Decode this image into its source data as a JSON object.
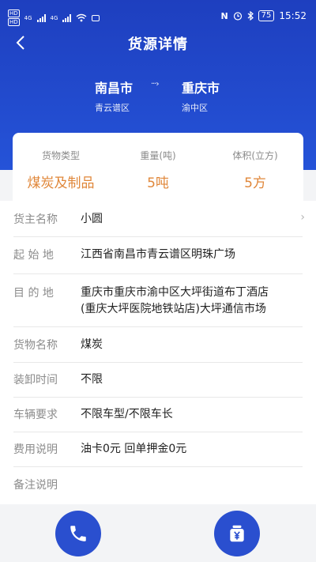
{
  "status_bar": {
    "left_badges": [
      "HD",
      "HD"
    ],
    "network_labels": [
      "4G",
      "4G"
    ],
    "battery": "75",
    "time": "15:52"
  },
  "nav": {
    "title": "货源详情"
  },
  "route": {
    "from_city": "南昌市",
    "from_district": "青云谱区",
    "to_city": "重庆市",
    "to_district": "渝中区"
  },
  "summary": {
    "cargo_type_label": "货物类型",
    "cargo_type_value": "煤炭及制品",
    "weight_label": "重量(吨)",
    "weight_value": "5吨",
    "volume_label": "体积(立方)",
    "volume_value": "5方"
  },
  "details": [
    {
      "key": "货主名称",
      "value": "小圆"
    },
    {
      "key": "起 始 地",
      "value": "江西省南昌市青云谱区明珠广场"
    },
    {
      "key": "目 的 地",
      "value_line1": "重庆市重庆市渝中区大坪街道布丁酒店",
      "value_line2": "(重庆大坪医院地铁站店)大坪通信市场"
    },
    {
      "key": "货物名称",
      "value": "煤炭"
    },
    {
      "key": "装卸时间",
      "value": "不限"
    },
    {
      "key": "车辆要求",
      "value": "不限车型/不限车长"
    },
    {
      "key": "费用说明",
      "value": "油卡0元 回单押金0元"
    },
    {
      "key": "备注说明",
      "value": ""
    }
  ],
  "colors": {
    "header": "#1e3fbf",
    "accent_orange": "#e0873a",
    "action_blue": "#2a4fcf"
  },
  "icons": {
    "back": "back-arrow-icon",
    "phone": "phone-icon",
    "wallet": "wallet-yen-icon"
  }
}
